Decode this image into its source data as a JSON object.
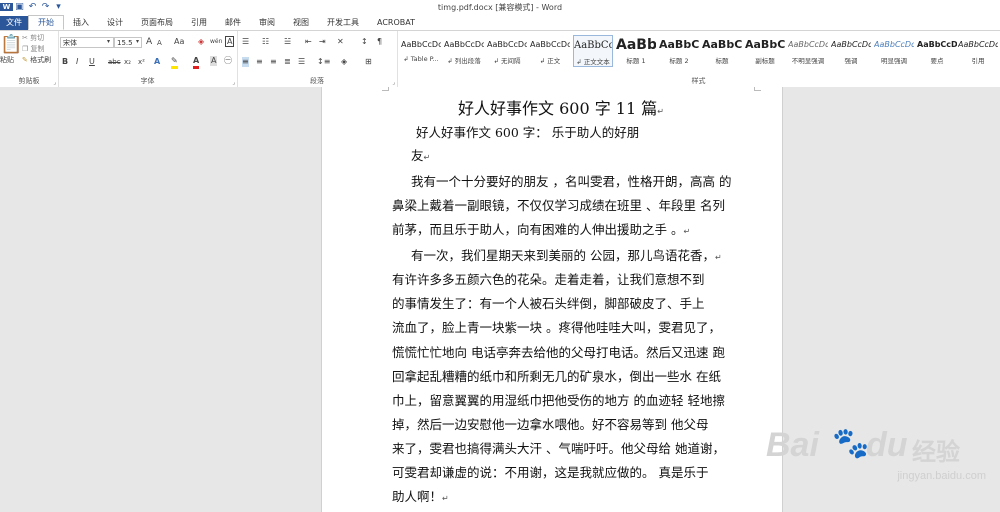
{
  "window": {
    "title": "timg.pdf.docx [兼容模式] - Word"
  },
  "tabs": [
    "文件",
    "开始",
    "插入",
    "设计",
    "页面布局",
    "引用",
    "邮件",
    "审阅",
    "视图",
    "开发工具",
    "ACROBAT"
  ],
  "clipboard": {
    "paste": "粘贴",
    "cut": "剪切",
    "copy": "复制",
    "painter": "格式刷",
    "label": "剪贴板"
  },
  "font": {
    "name": "宋体",
    "size": "15.5",
    "label": "字体",
    "bold": "B",
    "italic": "I",
    "underline": "U",
    "strike": "abc",
    "sub": "x₂",
    "sup": "x²",
    "grow": "A",
    "shrink": "A",
    "case": "Aa",
    "clear": "A",
    "phonetic": "wén",
    "border": "A"
  },
  "paragraph": {
    "label": "段落"
  },
  "styles": {
    "label": "样式",
    "items": [
      {
        "sample": "AaBbCcDc",
        "name": "↲ Table P..."
      },
      {
        "sample": "AaBbCcDc",
        "name": "↲ 列出段落"
      },
      {
        "sample": "AaBbCcDc",
        "name": "↲ 无间隔"
      },
      {
        "sample": "AaBbCcDc",
        "name": "↲ 正文"
      },
      {
        "sample": "AaBbCc",
        "name": "↲ 正文文本"
      },
      {
        "sample": "AaBb",
        "name": "标题 1"
      },
      {
        "sample": "AaBbC",
        "name": "标题 2"
      },
      {
        "sample": "AaBbC",
        "name": "标题"
      },
      {
        "sample": "AaBbC",
        "name": "副标题"
      },
      {
        "sample": "AaBbCcDc",
        "name": "不明显强调"
      },
      {
        "sample": "AaBbCcDc",
        "name": "强调"
      },
      {
        "sample": "AaBbCcDc",
        "name": "明显强调"
      },
      {
        "sample": "AaBbCcDc",
        "name": "要点"
      },
      {
        "sample": "AaBbCcDc",
        "name": "引用"
      }
    ]
  },
  "document": {
    "lines": [
      "好人好事作文  600 字 11 篇",
      "好人好事作文 600 字：    乐于助人的好朋",
      "友",
      "我有一个十分要好的朋友 ，名叫雯君，性格开朗，高高  的",
      "鼻梁上戴着一副眼镜，不仅仅学习成绩在班里 、年段里  名列",
      "前茅，而且乐于助人，向有困难的人伸出援助之手 。",
      "有一次，我们星期天来到美丽的 公园，那儿鸟语花香，",
      "有许许多多五颜六色的花朵。走着走着，让我们意想不到",
      "的事情发生了：有一个人被石头绊倒，脚部破皮了、手上",
      "流血了，脸上青一块紫一块 。疼得他哇哇大叫，雯君见了，",
      "慌慌忙忙地向 电话亭奔去给他的父母打电话。然后又迅速  跑",
      "回拿起乱糟糟的纸巾和所剩无几的矿泉水，倒出一些水  在纸",
      "巾上，留意翼翼的用湿纸巾把他受伤的地方 的血迹轻  轻地擦",
      "掉，然后一边安慰他一边拿水喂他。好不容易等到  他父母",
      "来了，雯君也搞得满头大汗 、气喘吁吁。他父母给  她道谢，",
      "可雯君却谦虚的说：不用谢，这是我就应做的。     真是乐于",
      "助人啊！"
    ],
    "para_mark": "↵"
  },
  "watermark": {
    "brand": "Bai",
    "paw": "du",
    "cn": "经验",
    "url": "jingyan.baidu.com"
  }
}
